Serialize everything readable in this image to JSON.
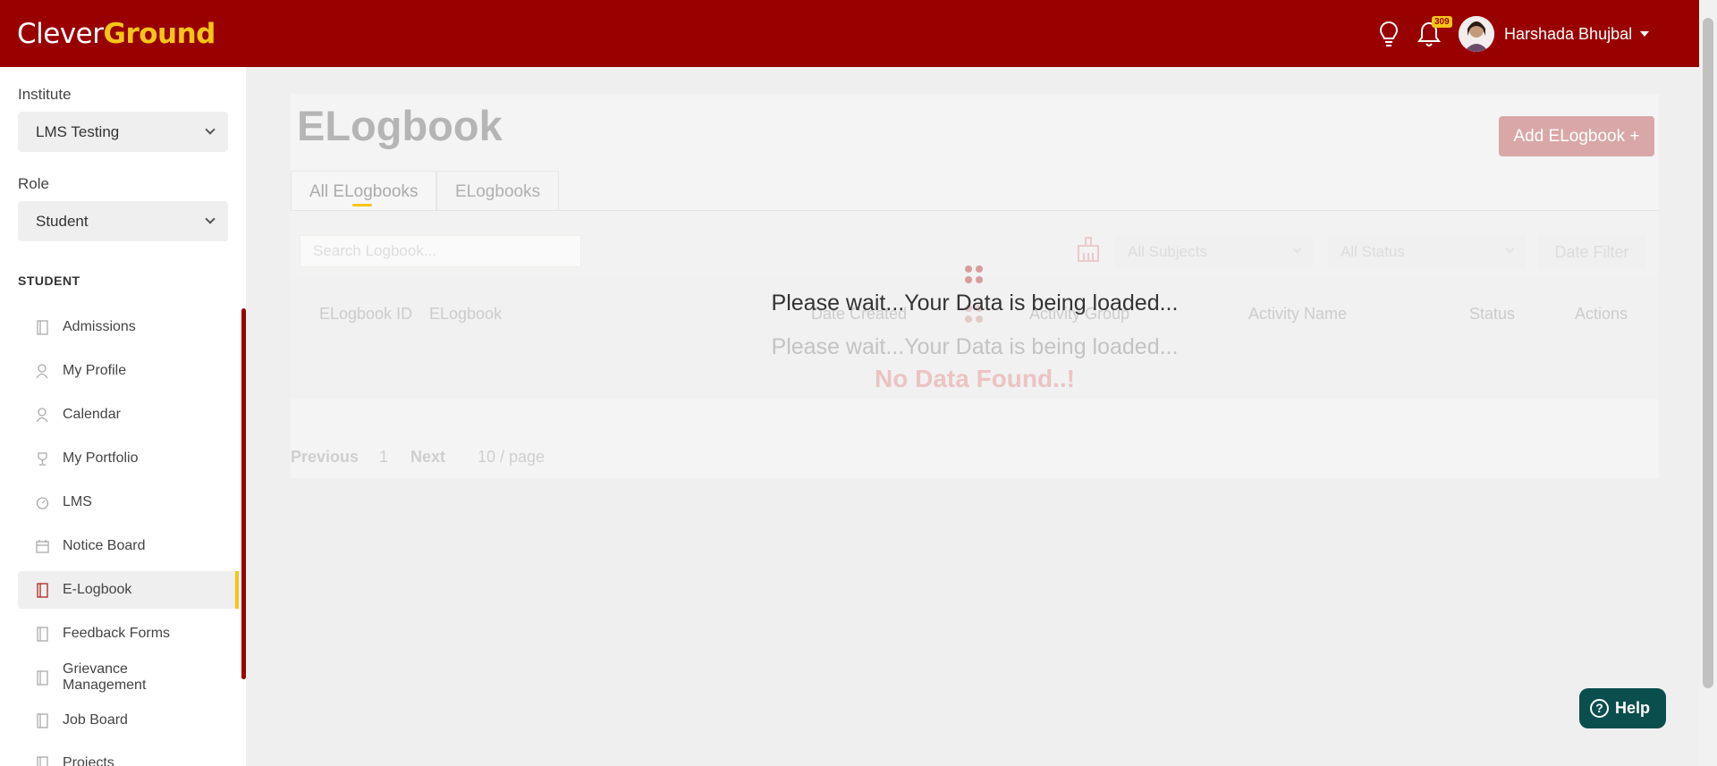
{
  "header": {
    "logo_part1": "Clever",
    "logo_part2": "Ground",
    "notification_count": "309",
    "user_name": "Harshada Bhujbal"
  },
  "sidebar": {
    "institute_label": "Institute",
    "institute_value": "LMS Testing",
    "role_label": "Role",
    "role_value": "Student",
    "section_title": "STUDENT",
    "items": [
      {
        "label": "Admissions",
        "icon": "book-icon"
      },
      {
        "label": "My Profile",
        "icon": "profile-icon"
      },
      {
        "label": "Calendar",
        "icon": "calendar-person-icon"
      },
      {
        "label": "My Portfolio",
        "icon": "trophy-icon"
      },
      {
        "label": "LMS",
        "icon": "gauge-icon"
      },
      {
        "label": "Notice Board",
        "icon": "calendar-icon"
      },
      {
        "label": "E-Logbook",
        "icon": "book-icon"
      },
      {
        "label": "Feedback Forms",
        "icon": "book-icon"
      },
      {
        "label": "Grievance Management",
        "icon": "book-icon"
      },
      {
        "label": "Job Board",
        "icon": "book-icon"
      },
      {
        "label": "Projects",
        "icon": "book-icon"
      }
    ],
    "active_item": "E-Logbook"
  },
  "main": {
    "title": "ELogbook",
    "add_button": "Add ELogbook +",
    "tabs": [
      "All ELogbooks",
      "ELogbooks"
    ],
    "search_placeholder": "Search Logbook...",
    "subjects_filter": "All Subjects",
    "status_filter": "All Status",
    "date_filter": "Date Filter",
    "columns": [
      "ELogbook ID",
      "ELogbook",
      "Date Created",
      "Activity Group",
      "Activity Name",
      "Status",
      "Actions"
    ],
    "loading_text": "Please wait...Your Data is being loaded...",
    "empty_text": "No Data Found..!",
    "pager": {
      "previous": "Previous",
      "page": "1",
      "next": "Next",
      "page_size": "10 / page"
    }
  },
  "overlay": {
    "loading_text": "Please wait...Your Data is being loaded..."
  },
  "help_button": "Help",
  "colors": {
    "brand": "#990000",
    "accent": "#f5c518",
    "help": "#0b4e4e"
  }
}
